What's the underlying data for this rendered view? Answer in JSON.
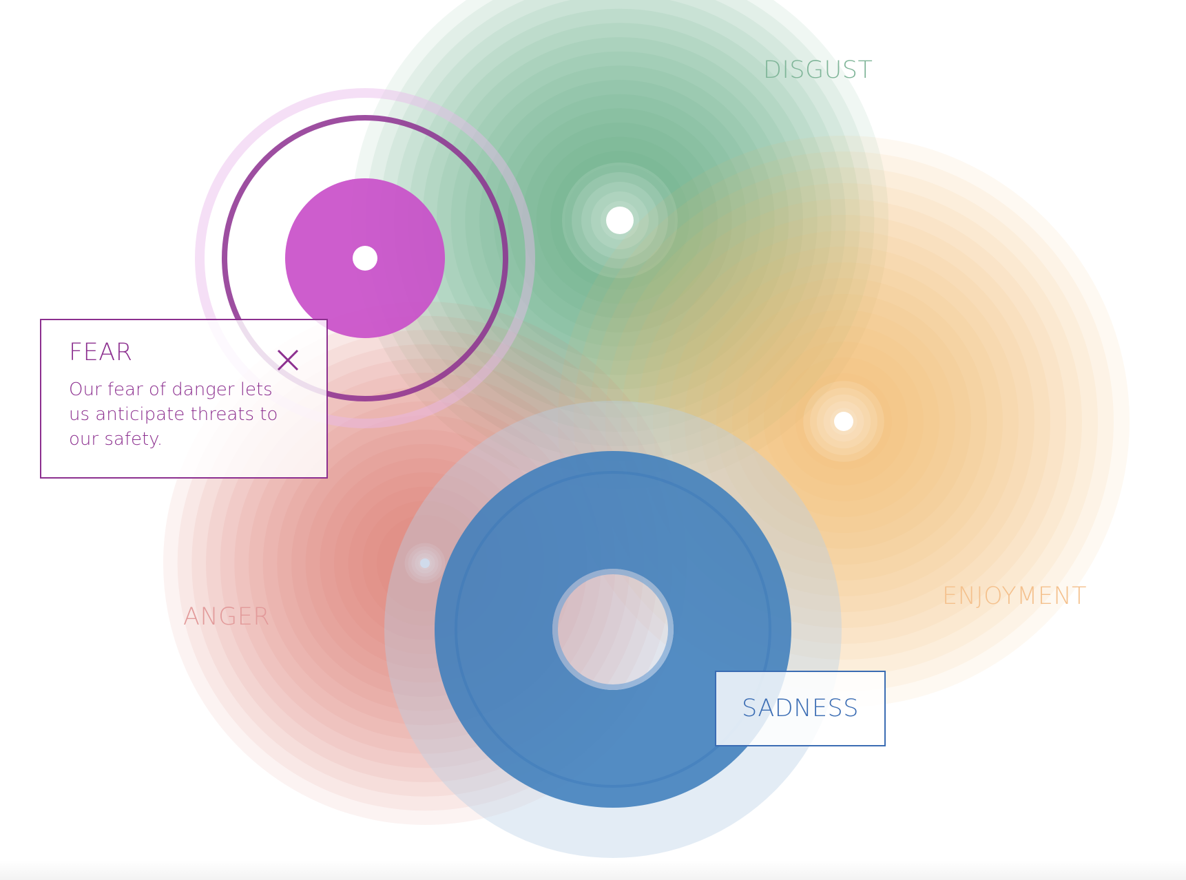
{
  "colors": {
    "fear": "#c94fc9",
    "fear_ring": "#8c2f8f",
    "fear_text": "#8c2f8f",
    "disgust": "#5da97f",
    "disgust_text": "#7fb598",
    "enjoyment": "#f7b566",
    "enjoyment_text": "#f4c08c",
    "anger": "#e0706a",
    "anger_text": "#e29a9a",
    "sadness": "#3f7ebc",
    "sadness_light": "#b8cfe6",
    "sadness_text": "#3a6cb3"
  },
  "emotions": {
    "fear": {
      "title": "FEAR",
      "description": "Our fear of danger lets us anticipate threats to our safety.",
      "close_icon": "close-icon"
    },
    "disgust": {
      "label": "DISGUST"
    },
    "enjoyment": {
      "label": "ENJOYMENT"
    },
    "anger": {
      "label": "ANGER"
    },
    "sadness": {
      "label": "SADNESS"
    }
  }
}
